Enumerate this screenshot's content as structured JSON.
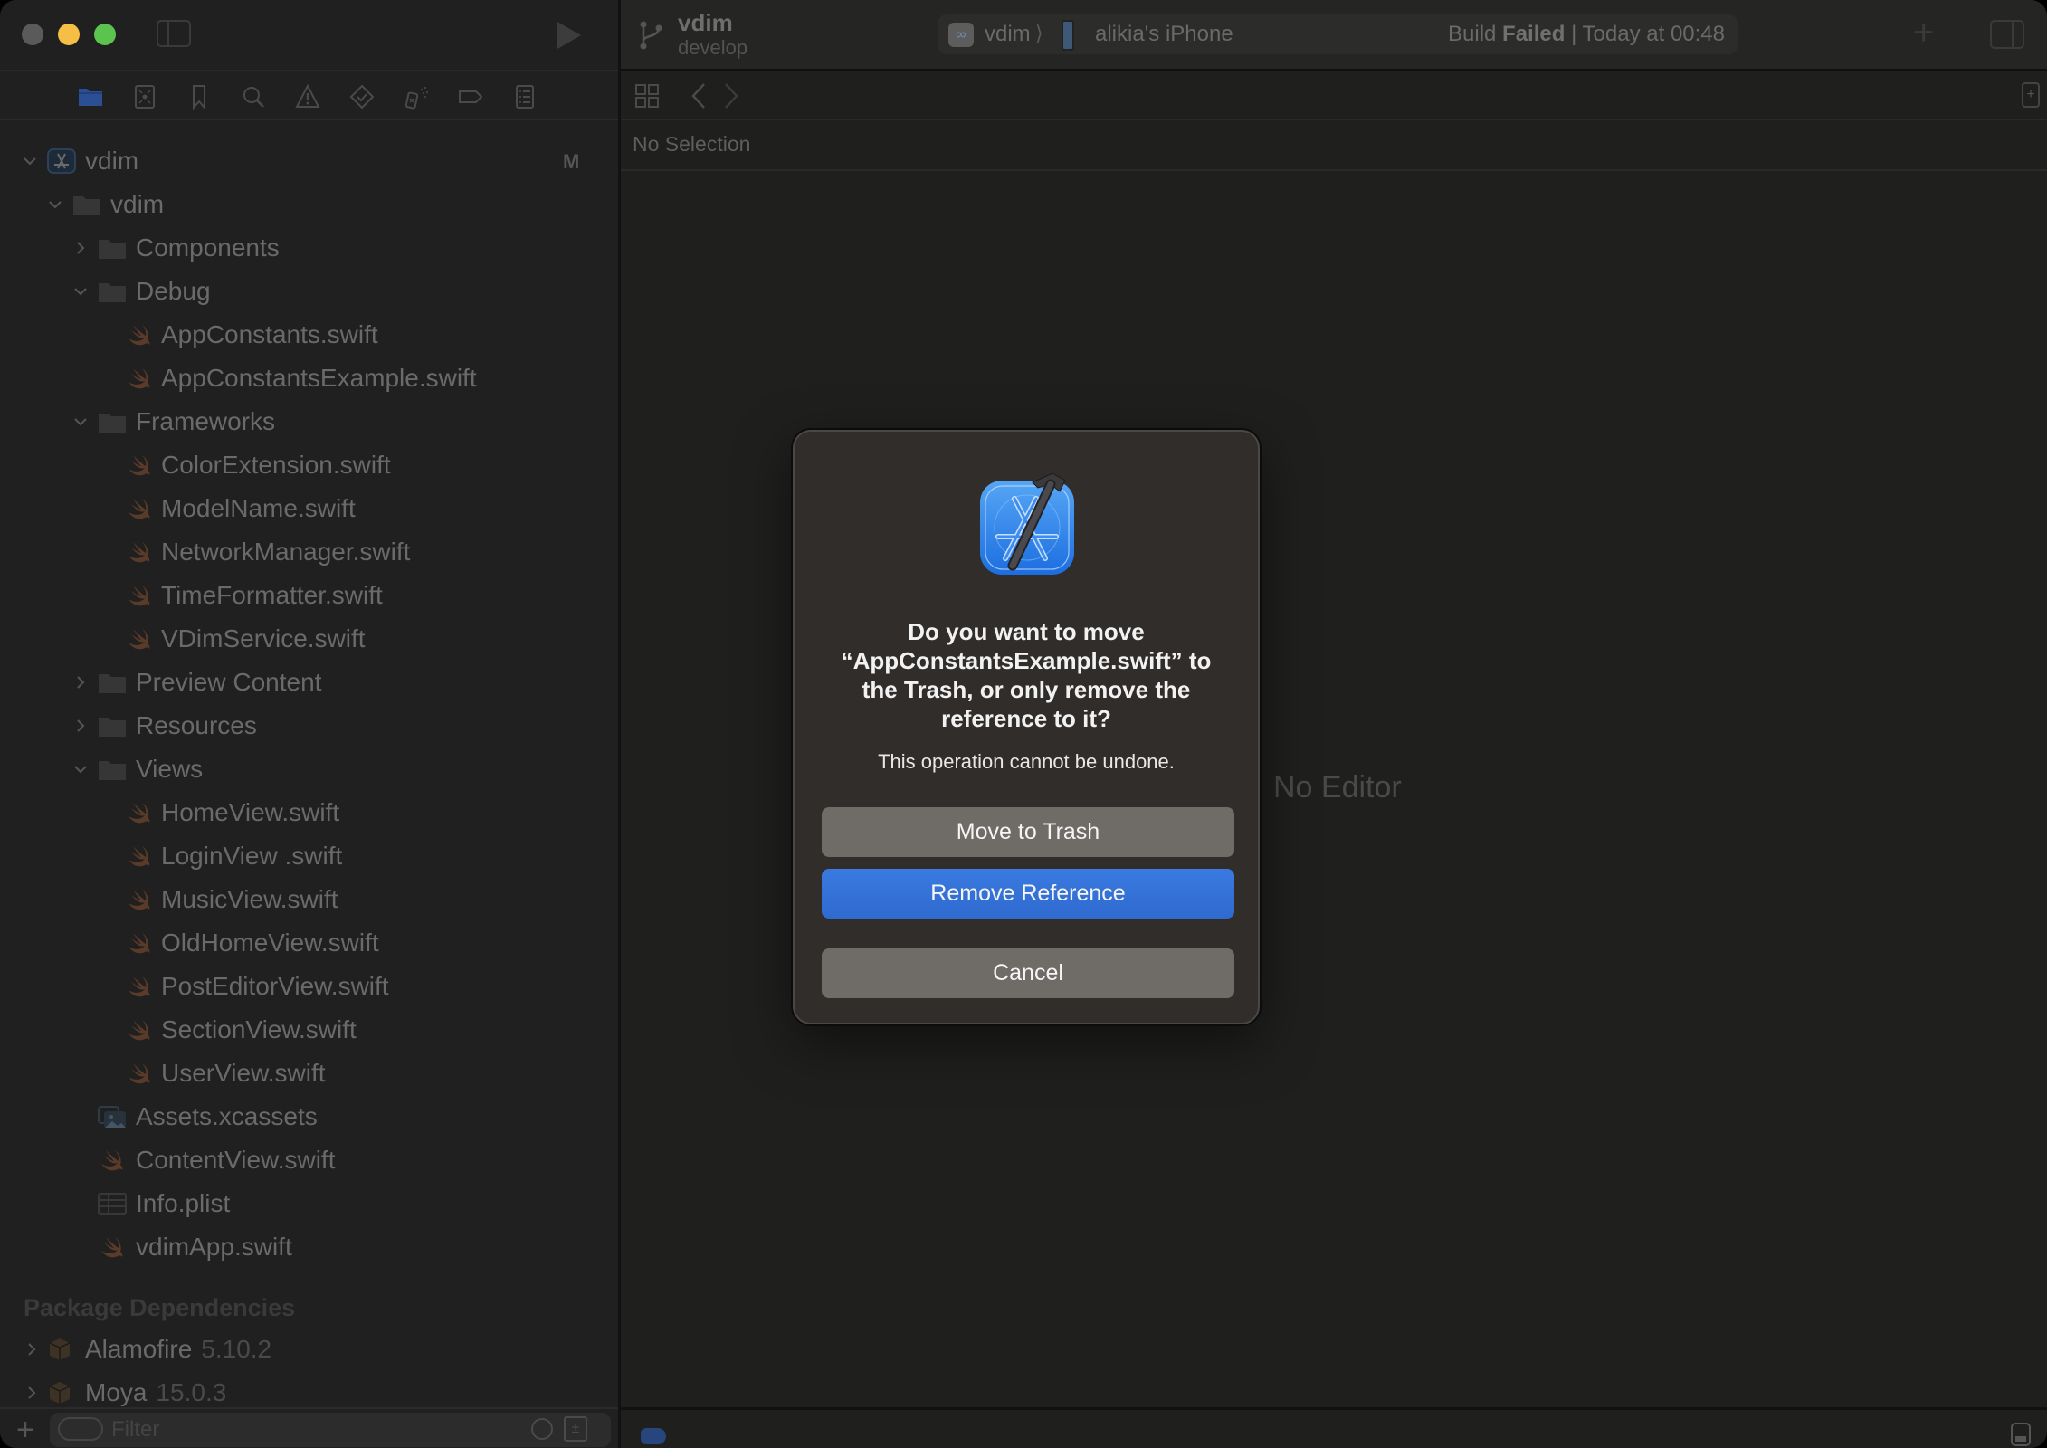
{
  "window": {
    "traffic_lights": [
      "close",
      "minimize",
      "maximize"
    ]
  },
  "sidebar": {
    "navigator_tabs": [
      {
        "name": "project-navigator",
        "icon": "folder-icon",
        "active": true
      },
      {
        "name": "source-control-navigator",
        "icon": "source-control-icon",
        "active": false
      },
      {
        "name": "bookmark-navigator",
        "icon": "bookmark-icon",
        "active": false
      },
      {
        "name": "find-navigator",
        "icon": "search-icon",
        "active": false
      },
      {
        "name": "issue-navigator",
        "icon": "warning-icon",
        "active": false
      },
      {
        "name": "test-navigator",
        "icon": "test-diamond-icon",
        "active": false
      },
      {
        "name": "debug-navigator",
        "icon": "spray-icon",
        "active": false
      },
      {
        "name": "breakpoint-navigator",
        "icon": "breakpoint-icon",
        "active": false
      },
      {
        "name": "report-navigator",
        "icon": "report-icon",
        "active": false
      }
    ],
    "tree": [
      {
        "label": "vdim",
        "type": "project",
        "level": 0,
        "expanded": true,
        "badge": "M"
      },
      {
        "label": "vdim",
        "type": "folder",
        "level": 1,
        "expanded": true
      },
      {
        "label": "Components",
        "type": "folder",
        "level": 2,
        "expanded": false
      },
      {
        "label": "Debug",
        "type": "folder",
        "level": 2,
        "expanded": true
      },
      {
        "label": "AppConstants.swift",
        "type": "swift",
        "level": 3
      },
      {
        "label": "AppConstantsExample.swift",
        "type": "swift",
        "level": 3
      },
      {
        "label": "Frameworks",
        "type": "folder",
        "level": 2,
        "expanded": true
      },
      {
        "label": "ColorExtension.swift",
        "type": "swift",
        "level": 3
      },
      {
        "label": "ModelName.swift",
        "type": "swift",
        "level": 3
      },
      {
        "label": "NetworkManager.swift",
        "type": "swift",
        "level": 3
      },
      {
        "label": "TimeFormatter.swift",
        "type": "swift",
        "level": 3
      },
      {
        "label": "VDimService.swift",
        "type": "swift",
        "level": 3
      },
      {
        "label": "Preview Content",
        "type": "folder",
        "level": 2,
        "expanded": false
      },
      {
        "label": "Resources",
        "type": "folder",
        "level": 2,
        "expanded": false
      },
      {
        "label": "Views",
        "type": "folder",
        "level": 2,
        "expanded": true
      },
      {
        "label": "HomeView.swift",
        "type": "swift",
        "level": 3
      },
      {
        "label": "LoginView .swift",
        "type": "swift",
        "level": 3
      },
      {
        "label": "MusicView.swift",
        "type": "swift",
        "level": 3
      },
      {
        "label": "OldHomeView.swift",
        "type": "swift",
        "level": 3
      },
      {
        "label": "PostEditorView.swift",
        "type": "swift",
        "level": 3
      },
      {
        "label": "SectionView.swift",
        "type": "swift",
        "level": 3
      },
      {
        "label": "UserView.swift",
        "type": "swift",
        "level": 3
      },
      {
        "label": "Assets.xcassets",
        "type": "assets",
        "level": 2
      },
      {
        "label": "ContentView.swift",
        "type": "swift",
        "level": 2
      },
      {
        "label": "Info.plist",
        "type": "plist",
        "level": 2
      },
      {
        "label": "vdimApp.swift",
        "type": "swift",
        "level": 2
      }
    ],
    "package_section_title": "Package Dependencies",
    "packages": [
      {
        "name": "Alamofire",
        "version": "5.10.2"
      },
      {
        "name": "Moya",
        "version": "15.0.3"
      }
    ],
    "filter": {
      "placeholder": "Filter",
      "value": ""
    }
  },
  "toolbar": {
    "project_name": "vdim",
    "branch": "develop",
    "scheme": "vdim",
    "scheme_separator": "⟩",
    "device": "alikia's iPhone",
    "build_status_prefix": "Build",
    "build_status_result": "Failed",
    "build_status_time": "| Today at 00:48"
  },
  "editor": {
    "jump_bar_text": "No Selection",
    "placeholder": "No Editor"
  },
  "dialog": {
    "title": "Do you want to move “AppConstantsExample.swift” to the Trash, or only remove the reference to it?",
    "message": "This operation cannot be undone.",
    "buttons": {
      "move_to_trash": "Move to Trash",
      "remove_reference": "Remove Reference",
      "cancel": "Cancel"
    }
  },
  "colors": {
    "accent_blue": "#3275dc",
    "swift_icon": "#5a3a28",
    "active_tab": "#2a4f94",
    "traffic_min": "#f5bf45",
    "traffic_max": "#5bc44f"
  }
}
